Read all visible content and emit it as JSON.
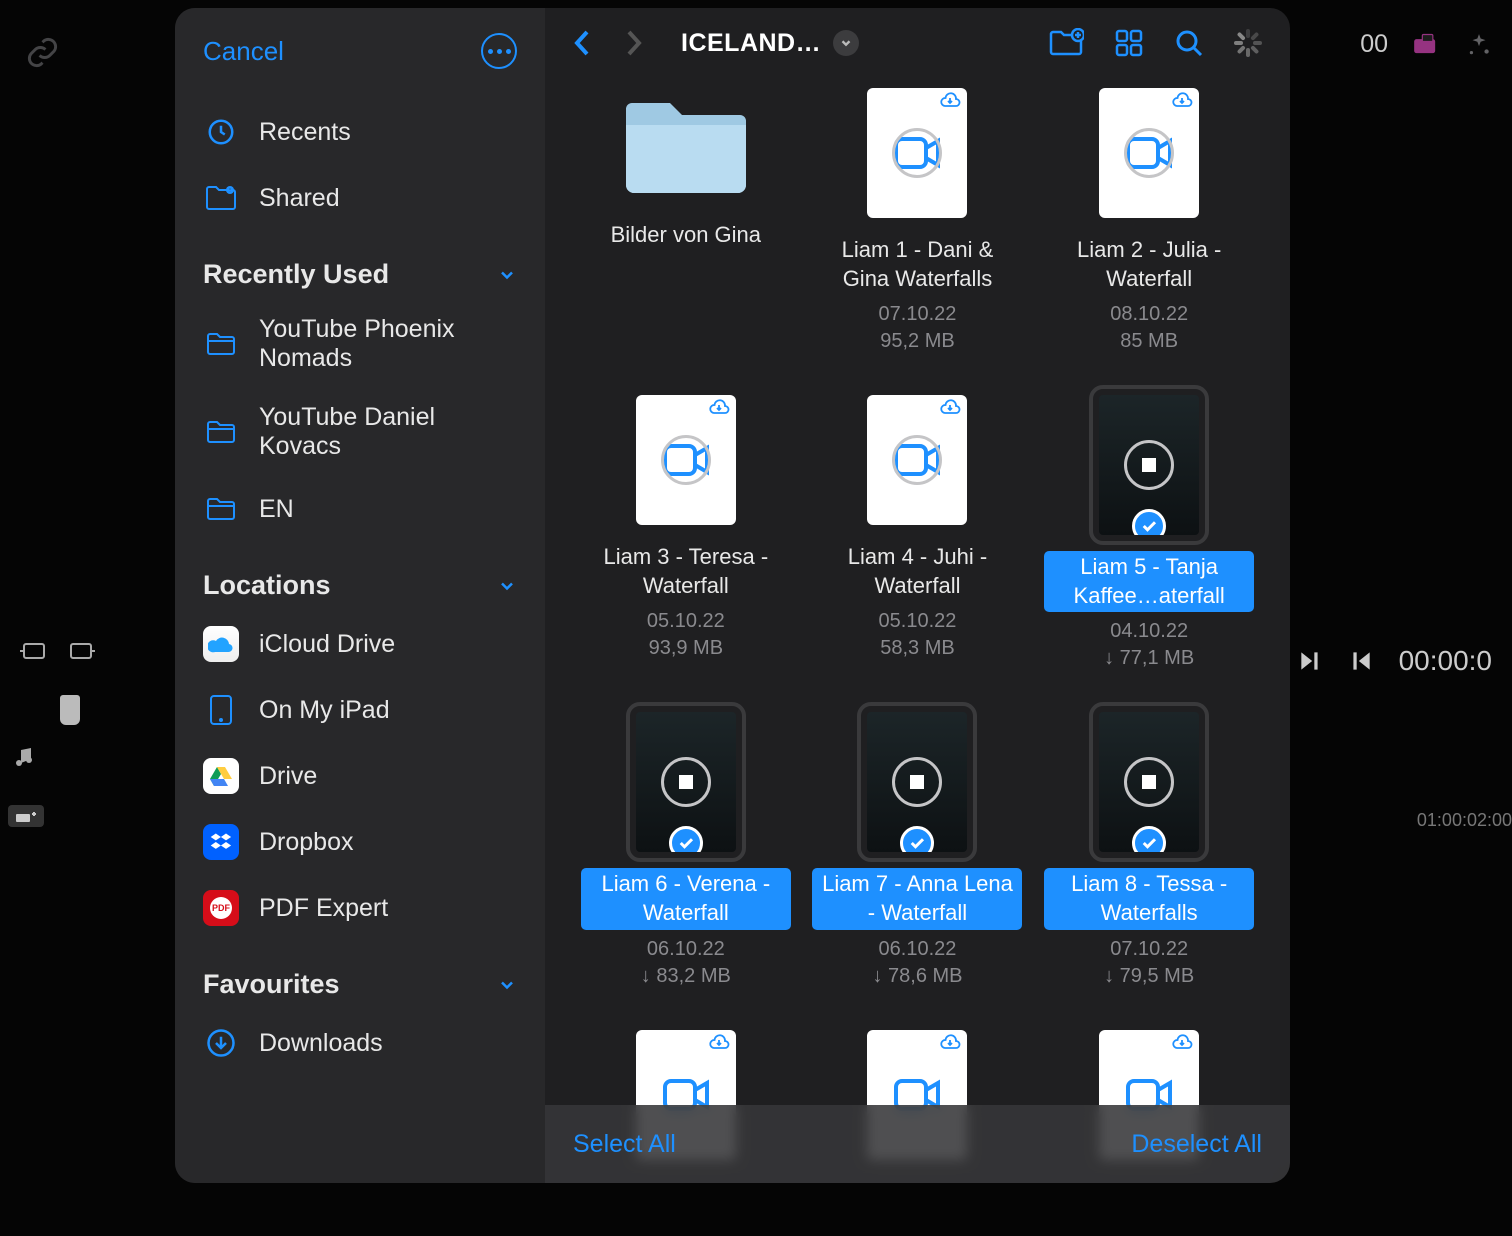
{
  "background": {
    "timecode_top": "00",
    "timecode_right": "00:00:0",
    "timeline_marker": "01:00:02:00"
  },
  "modal": {
    "cancel": "Cancel",
    "sections": {
      "top": [
        {
          "icon": "clock-icon",
          "label": "Recents"
        },
        {
          "icon": "shared-folder-icon",
          "label": "Shared"
        }
      ],
      "recently_used": {
        "title": "Recently Used",
        "items": [
          {
            "label": "YouTube Phoenix Nomads"
          },
          {
            "label": "YouTube Daniel Kovacs"
          },
          {
            "label": "EN"
          }
        ]
      },
      "locations": {
        "title": "Locations",
        "items": [
          {
            "icon": "icloud",
            "label": "iCloud Drive"
          },
          {
            "icon": "ipad",
            "label": "On My iPad"
          },
          {
            "icon": "gdrive",
            "label": "Drive"
          },
          {
            "icon": "dropbox",
            "label": "Dropbox"
          },
          {
            "icon": "pdfexpert",
            "label": "PDF Expert"
          }
        ]
      },
      "favourites": {
        "title": "Favourites",
        "items": [
          {
            "icon": "download-circle",
            "label": "Downloads"
          }
        ]
      }
    },
    "toolbar": {
      "title": "ICELAND…"
    },
    "select_all": "Select All",
    "deselect_all": "Deselect All",
    "files": [
      {
        "kind": "folder",
        "name": "Bilder von Gina",
        "date": "",
        "size": "",
        "selected": false,
        "cloud": false,
        "downloading": false,
        "local_arrow": false
      },
      {
        "kind": "video",
        "name": "Liam 1 - Dani & Gina Waterfalls",
        "date": "07.10.22",
        "size": "95,2 MB",
        "selected": false,
        "cloud": true,
        "downloading": true,
        "local_arrow": false
      },
      {
        "kind": "video",
        "name": "Liam 2 - Julia - Waterfall",
        "date": "08.10.22",
        "size": "85 MB",
        "selected": false,
        "cloud": true,
        "downloading": true,
        "local_arrow": false
      },
      {
        "kind": "video",
        "name": "Liam 3 - Teresa - Waterfall",
        "date": "05.10.22",
        "size": "93,9 MB",
        "selected": false,
        "cloud": true,
        "downloading": true,
        "local_arrow": false
      },
      {
        "kind": "video",
        "name": "Liam 4 - Juhi - Waterfall",
        "date": "05.10.22",
        "size": "58,3 MB",
        "selected": false,
        "cloud": true,
        "downloading": true,
        "local_arrow": false
      },
      {
        "kind": "image",
        "name": "Liam 5 - Tanja Kaffee…aterfall",
        "date": "04.10.22",
        "size": "77,1 MB",
        "selected": true,
        "cloud": false,
        "downloading": true,
        "local_arrow": true
      },
      {
        "kind": "image",
        "name": "Liam 6 - Verena - Waterfall",
        "date": "06.10.22",
        "size": "83,2 MB",
        "selected": true,
        "cloud": false,
        "downloading": true,
        "local_arrow": true
      },
      {
        "kind": "image",
        "name": "Liam 7 - Anna Lena - Waterfall",
        "date": "06.10.22",
        "size": "78,6 MB",
        "selected": true,
        "cloud": false,
        "downloading": true,
        "local_arrow": true
      },
      {
        "kind": "image",
        "name": "Liam 8 - Tessa - Waterfalls",
        "date": "07.10.22",
        "size": "79,5 MB",
        "selected": true,
        "cloud": false,
        "downloading": true,
        "local_arrow": true
      },
      {
        "kind": "video",
        "name": "",
        "date": "",
        "size": "",
        "selected": false,
        "cloud": true,
        "downloading": false,
        "local_arrow": false
      },
      {
        "kind": "video",
        "name": "",
        "date": "",
        "size": "",
        "selected": false,
        "cloud": true,
        "downloading": false,
        "local_arrow": false
      },
      {
        "kind": "video",
        "name": "",
        "date": "",
        "size": "",
        "selected": false,
        "cloud": true,
        "downloading": false,
        "local_arrow": false
      }
    ]
  },
  "colors": {
    "accent": "#1e90ff"
  }
}
